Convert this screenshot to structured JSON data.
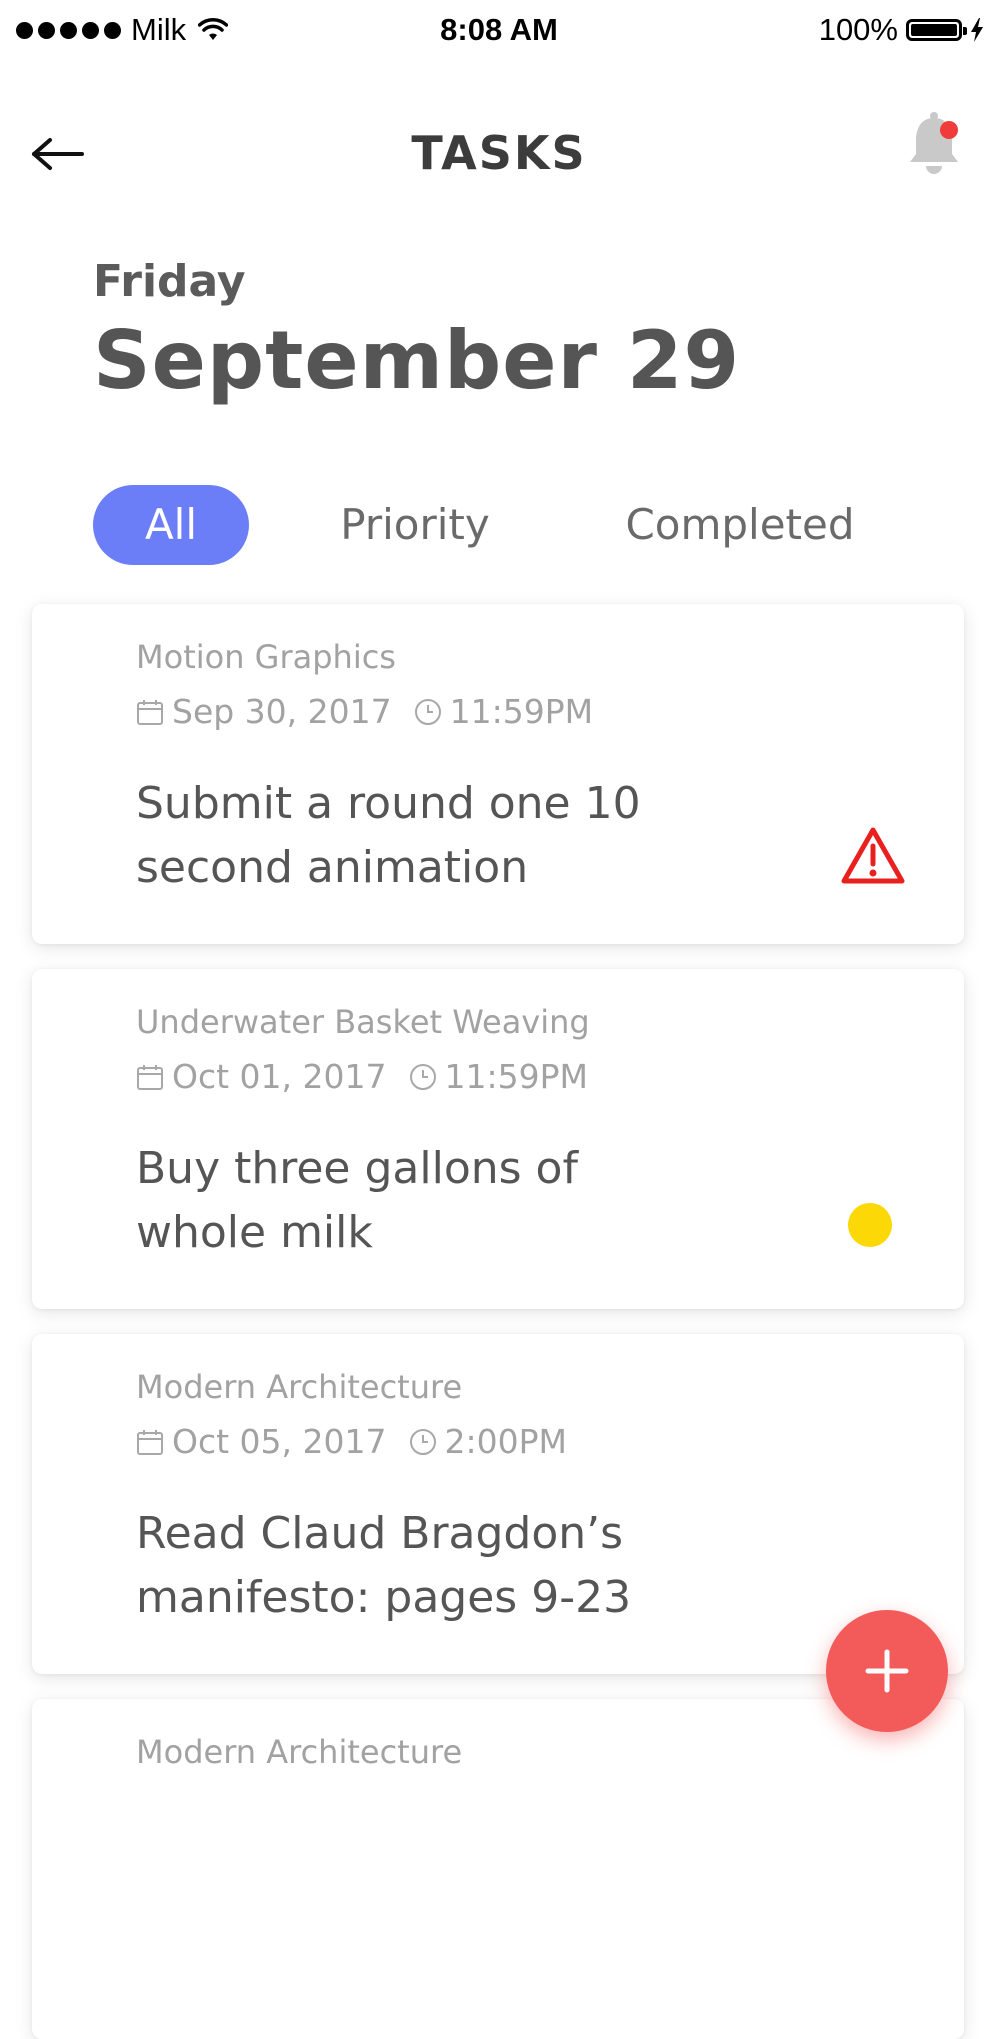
{
  "status_bar": {
    "carrier": "Milk",
    "time": "8:08 AM",
    "battery": "100%"
  },
  "header": {
    "title": "TASKS"
  },
  "date": {
    "day": "Friday",
    "full": "September 29"
  },
  "tabs": [
    {
      "label": "All",
      "active": true
    },
    {
      "label": "Priority",
      "active": false
    },
    {
      "label": "Completed",
      "active": false
    }
  ],
  "tasks": [
    {
      "course": "Motion Graphics",
      "due_date": "Sep 30, 2017",
      "due_time": "11:59PM",
      "title": "Submit a round one 10 second animation",
      "indicator": "warning-icon",
      "indicator_color": "#e8211f"
    },
    {
      "course": "Underwater Basket Weaving",
      "due_date": "Oct 01, 2017",
      "due_time": "11:59PM",
      "title": "Buy three gallons of whole milk",
      "indicator": "yellow-dot",
      "indicator_color": "#fbd806"
    },
    {
      "course": "Modern Architecture",
      "due_date": "Oct 05, 2017",
      "due_time": "2:00PM",
      "title": "Read Claud Bragdon’s manifesto: pages 9-23",
      "indicator": "none"
    },
    {
      "course": "Modern Architecture"
    }
  ],
  "colors": {
    "accent": "#6c7ef7",
    "fab": "#f35a5a",
    "notification_dot": "#f03b3b"
  },
  "icons": {
    "back": "arrow-left-icon",
    "notifications": "bell-icon",
    "add": "plus-icon"
  }
}
